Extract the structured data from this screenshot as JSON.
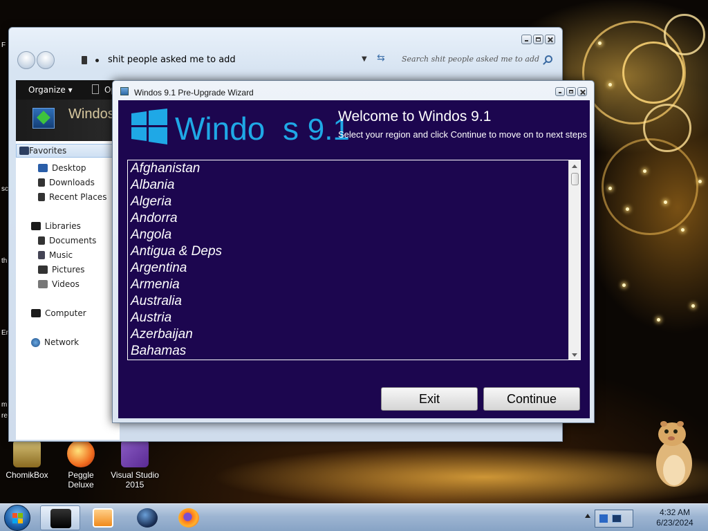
{
  "explorer": {
    "address": "shit people asked me to add",
    "search_placeholder": "Search shit people asked me to add",
    "toolbar": {
      "organize": "Organize ▾",
      "second": "Op"
    },
    "header_text": "Windos",
    "nav": {
      "favorites": "Favorites",
      "desktop": "Desktop",
      "downloads": "Downloads",
      "recent_places": "Recent Places",
      "libraries": "Libraries",
      "documents": "Documents",
      "music": "Music",
      "pictures": "Pictures",
      "videos": "Videos",
      "computer": "Computer",
      "network": "Network"
    }
  },
  "wizard": {
    "title": "Windos 9.1 Pre-Upgrade Wizard",
    "logo_text": "Windo  s",
    "logo_version": "9.1",
    "welcome": "Welcome to Windos 9.1",
    "subtitle": "Select your region and click Continue to move on to next steps",
    "countries": [
      "Afghanistan",
      "Albania",
      "Algeria",
      "Andorra",
      "Angola",
      "Antigua & Deps",
      "Argentina",
      "Armenia",
      "Australia",
      "Austria",
      "Azerbaijan",
      "Bahamas"
    ],
    "exit_label": "Exit",
    "continue_label": "Continue"
  },
  "desktop": {
    "icons": [
      "ChomikBox",
      "Peggle Deluxe",
      "Visual Studio 2015"
    ],
    "edge_labels": [
      "F",
      "sc",
      "th",
      "En",
      "m",
      "re"
    ]
  },
  "taskbar": {
    "time": "4:32 AM",
    "date": "6/23/2024",
    "pinned": [
      "explorer-icon",
      "media-player-icon",
      "browser-globe-icon",
      "firefox-icon"
    ]
  },
  "colors": {
    "wizard_bg": "#1c064f",
    "logo_blue": "#1fa8e6",
    "taskbar": "#9db5d2"
  }
}
